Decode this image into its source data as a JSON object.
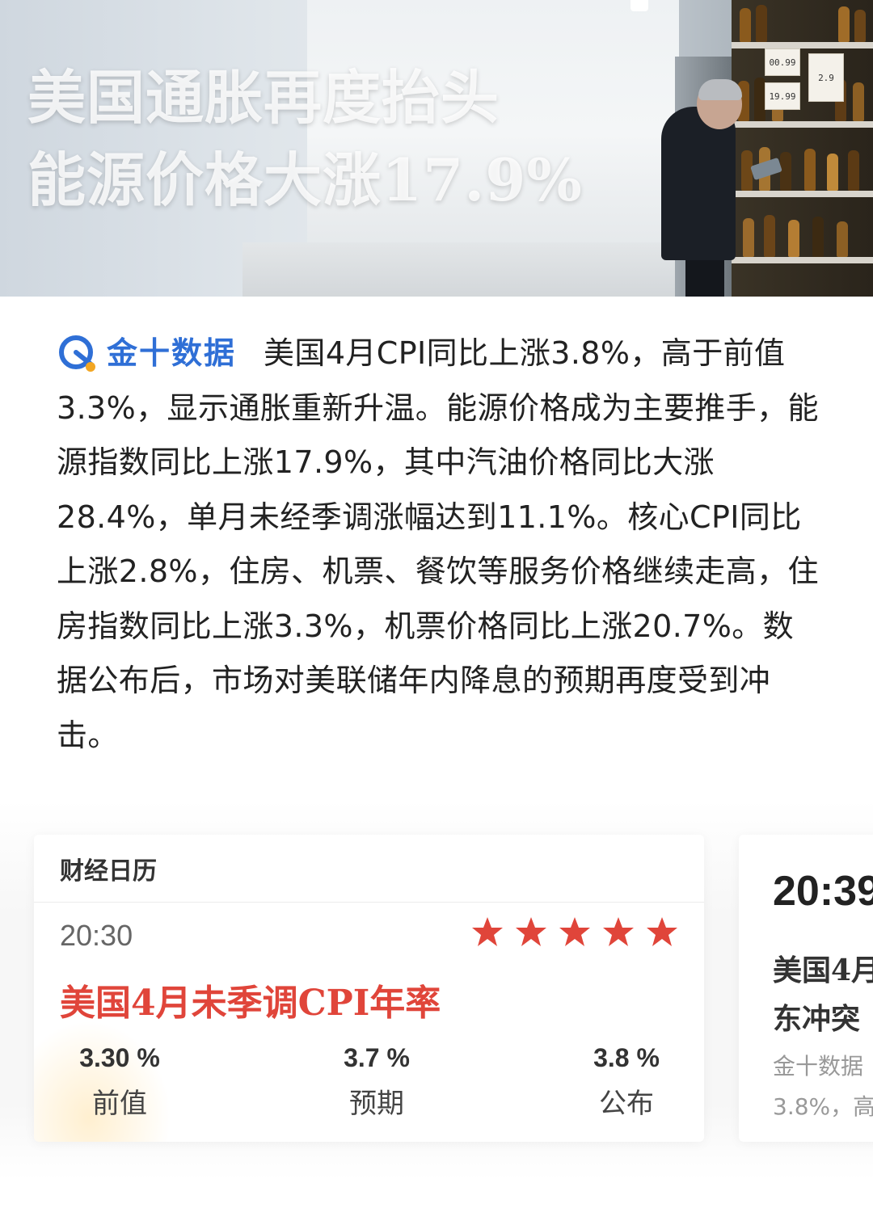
{
  "hero": {
    "title_line1": "美国通胀再度抬头",
    "title_line2": "能源价格大涨17.9%",
    "price_tags": [
      "00.99",
      "19.99",
      "2.9"
    ]
  },
  "article": {
    "brand_name": "金十数据",
    "body": "美国4月CPI同比上涨3.8%，高于前值3.3%，显示通胀重新升温。能源价格成为主要推手，能源指数同比上涨17.9%，其中汽油价格同比大涨28.4%，单月未经季调涨幅达到11.1%。核心CPI同比上涨2.8%，住房、机票、餐饮等服务价格继续走高，住房指数同比上涨3.3%，机票价格同比上涨20.7%。数据公布后，市场对美联储年内降息的预期再度受到冲击。"
  },
  "calendar_card": {
    "header": "财经日历",
    "time": "20:30",
    "importance_stars": 5,
    "event": "美国4月未季调CPI年率",
    "stats": [
      {
        "value": "3.30 %",
        "label": "前值"
      },
      {
        "value": "3.7 %",
        "label": "预期"
      },
      {
        "value": "3.8 %",
        "label": "公布"
      }
    ],
    "colors": {
      "event": "#e0453a",
      "stars": "#e0453a"
    }
  },
  "next_card": {
    "time": "20:39",
    "title_line1": "美国4月",
    "title_line2": "东冲突",
    "sub_line1": "金十数据",
    "sub_line2": "3.8%，高"
  },
  "colors": {
    "brand": "#2f6fd6",
    "accent_red": "#e0453a"
  }
}
